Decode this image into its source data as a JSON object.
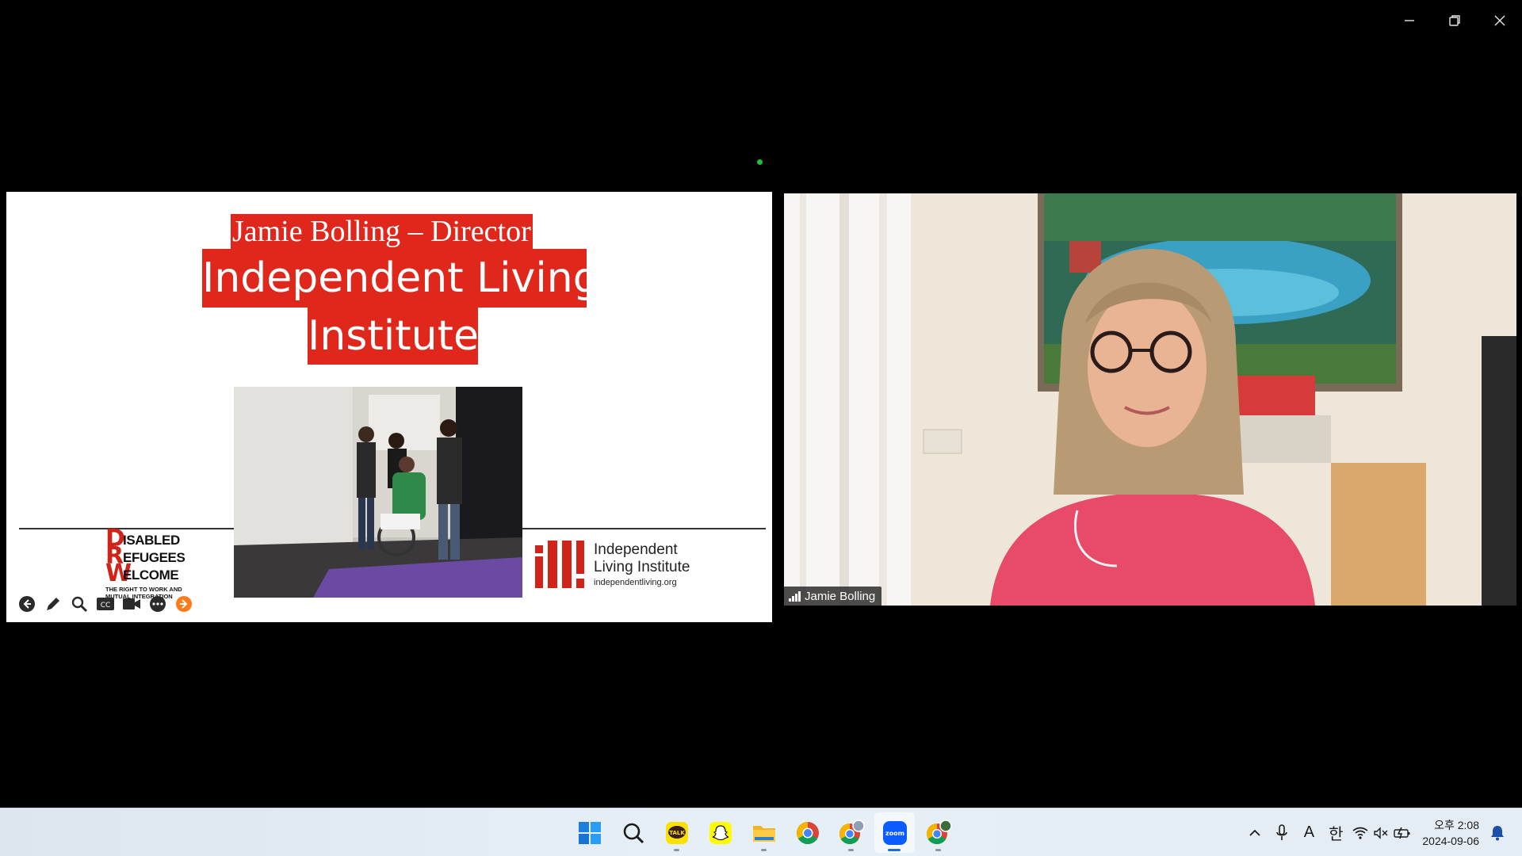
{
  "slide": {
    "presenter_line": "Jamie Bolling – Director",
    "title_line1": "Independent Living",
    "title_line2": "Institute",
    "left_logo": {
      "lines": [
        {
          "cap": "D",
          "rest": "ISABLED"
        },
        {
          "cap": "R",
          "rest": "EFUGEES"
        },
        {
          "cap": "W",
          "rest": "ELCOME"
        }
      ],
      "tagline": "THE RIGHT TO WORK AND MUTUAL INTEGRATION"
    },
    "right_logo": {
      "line1": "Independent",
      "line2": "Living Institute",
      "url": "independentliving.org"
    },
    "toolbar": [
      "back-arrow-icon",
      "pen-icon",
      "zoom-icon",
      "captions-icon",
      "camera-icon",
      "more-icon",
      "next-arrow-icon"
    ]
  },
  "participant": {
    "name": "Jamie Bolling"
  },
  "taskbar": {
    "apps": [
      {
        "name": "start",
        "label": "Start"
      },
      {
        "name": "search",
        "label": "Search"
      },
      {
        "name": "kakaotalk",
        "label": "TALK"
      },
      {
        "name": "snapchat",
        "label": "Snapchat"
      },
      {
        "name": "file-explorer",
        "label": "File Explorer"
      },
      {
        "name": "chrome",
        "label": "Chrome"
      },
      {
        "name": "chrome-profile",
        "label": "Chrome"
      },
      {
        "name": "zoom",
        "label": "zoom"
      },
      {
        "name": "chrome-profile-2",
        "label": "Chrome"
      }
    ],
    "tray": {
      "ime_letter": "A",
      "ime_lang": "한"
    },
    "clock": {
      "time": "오후 2:08",
      "date": "2024-09-06"
    }
  },
  "colors": {
    "slide_red": "#e0271c",
    "zoom_blue": "#0b5cff",
    "active_dot": "#1dbf3b",
    "next_orange": "#ff7a1a"
  }
}
